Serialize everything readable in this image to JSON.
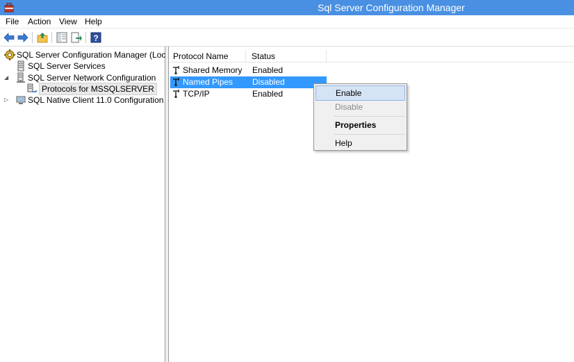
{
  "window": {
    "title": "Sql Server Configuration Manager",
    "titlebar_color": "#4a90e2"
  },
  "menubar": {
    "items": [
      "File",
      "Action",
      "View",
      "Help"
    ]
  },
  "toolbar": {
    "icons": [
      "back-arrow-icon",
      "forward-arrow-icon",
      "up-folder-icon",
      "show-hide-tree-icon",
      "export-list-icon",
      "help-icon"
    ]
  },
  "tree": {
    "root": "SQL Server Configuration Manager (Local)",
    "services": "SQL Server Services",
    "network": "SQL Server Network Configuration",
    "protocols": "Protocols for MSSQLSERVER",
    "native_client": "SQL Native Client 11.0 Configuration"
  },
  "list": {
    "columns": [
      "Protocol Name",
      "Status"
    ],
    "rows": [
      {
        "name": "Shared Memory",
        "status": "Enabled"
      },
      {
        "name": "Named Pipes",
        "status": "Disabled"
      },
      {
        "name": "TCP/IP",
        "status": "Enabled"
      }
    ],
    "selection_color": "#3399ff"
  },
  "context_menu": {
    "enable": "Enable",
    "disable": "Disable",
    "properties": "Properties",
    "help": "Help"
  }
}
